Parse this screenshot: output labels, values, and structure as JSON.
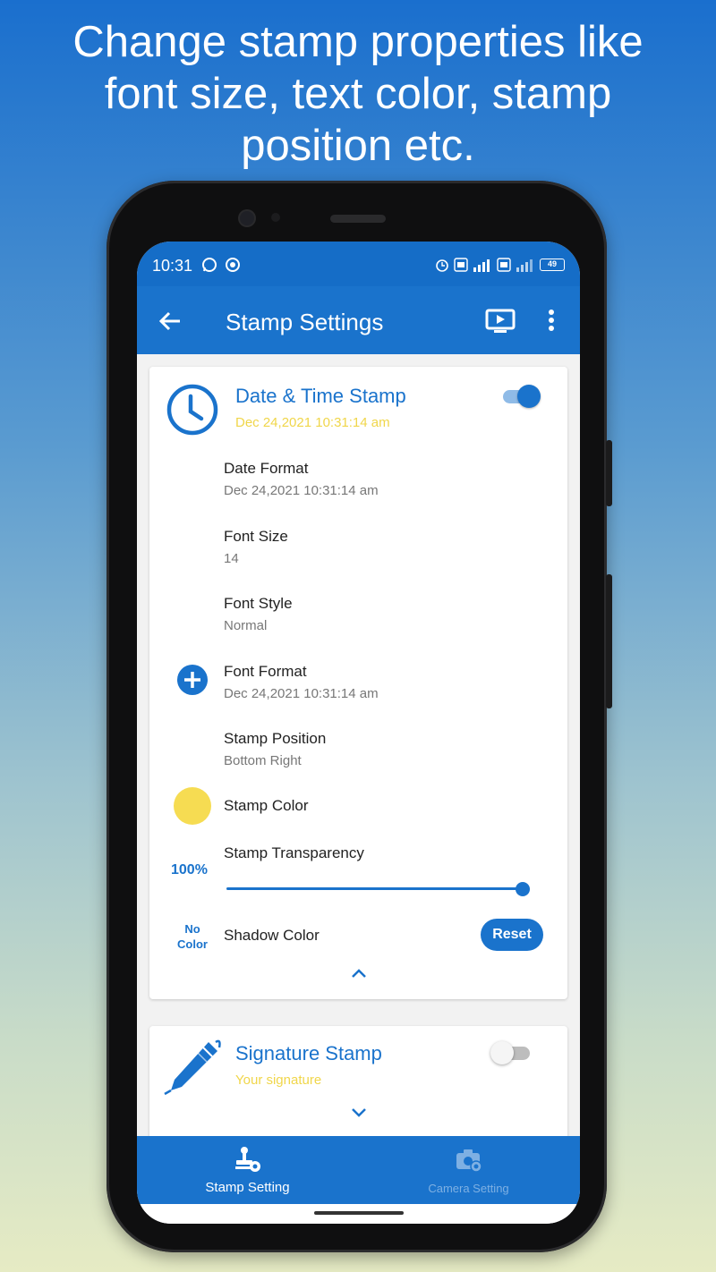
{
  "headline": "Change stamp properties like\nfont size, text color, stamp\nposition etc.",
  "status_bar": {
    "time": "10:31",
    "battery": "49",
    "icons": [
      "whatsapp-icon",
      "app-notification-icon",
      "alarm-icon",
      "volte-icon",
      "signal-icon",
      "4g-icon",
      "battery-icon"
    ]
  },
  "app_bar": {
    "title": "Stamp Settings",
    "icons": [
      "back-arrow-icon",
      "cast-icon",
      "more-vert-icon"
    ]
  },
  "date_time_card": {
    "title": "Date & Time Stamp",
    "subtitle": "Dec 24,2021 10:31:14 am",
    "enabled": true,
    "settings": [
      {
        "label": "Date Format",
        "value": "Dec 24,2021 10:31:14 am"
      },
      {
        "label": "Font Size",
        "value": "14"
      },
      {
        "label": "Font Style",
        "value": "Normal"
      },
      {
        "label": "Font Format",
        "value": "Dec 24,2021 10:31:14 am"
      },
      {
        "label": "Stamp Position",
        "value": "Bottom Right"
      },
      {
        "label": "Stamp Color",
        "value": ""
      },
      {
        "label": "Stamp Transparency",
        "value": ""
      },
      {
        "label": "Shadow Color",
        "value": ""
      }
    ],
    "stamp_color_hex": "#f6dc52",
    "transparency_percent": "100%",
    "transparency_value": 100,
    "shadow_none_label": "No\nColor",
    "reset_label": "Reset"
  },
  "signature_card": {
    "title": "Signature Stamp",
    "subtitle": "Your signature",
    "enabled": false
  },
  "bottom_nav": {
    "items": [
      {
        "label": "Stamp Setting",
        "active": true
      },
      {
        "label": "Camera Setting",
        "active": false
      }
    ]
  },
  "colors": {
    "primary": "#1a73cc",
    "accent_yellow": "#f0d64a"
  }
}
